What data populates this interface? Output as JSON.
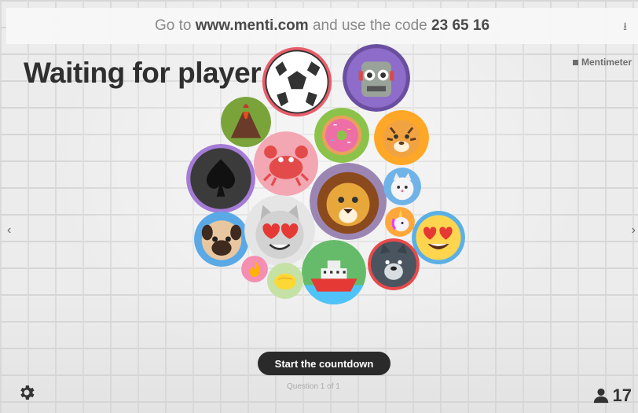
{
  "header": {
    "prefix": "Go to",
    "url": "www.menti.com",
    "middle": "and use the code",
    "code": "23 65 16",
    "download_icon": "download-icon"
  },
  "main": {
    "title": "Waiting for player",
    "brand": "Mentimeter"
  },
  "avatars": [
    {
      "name": "soccer-ball-avatar"
    },
    {
      "name": "robot-avatar"
    },
    {
      "name": "volcano-avatar"
    },
    {
      "name": "donut-avatar"
    },
    {
      "name": "tiger-avatar"
    },
    {
      "name": "crab-avatar"
    },
    {
      "name": "spade-avatar"
    },
    {
      "name": "lion-avatar"
    },
    {
      "name": "cat-avatar"
    },
    {
      "name": "unicorn-avatar"
    },
    {
      "name": "heart-eyes-avatar"
    },
    {
      "name": "pug-avatar"
    },
    {
      "name": "heart-eyes-cat-avatar"
    },
    {
      "name": "wolf-avatar"
    },
    {
      "name": "ship-avatar"
    },
    {
      "name": "fire-avatar"
    },
    {
      "name": "lemon-avatar"
    }
  ],
  "controls": {
    "start_label": "Start the countdown",
    "counter": "Question 1 of 1",
    "players_count": "17",
    "colors": {
      "button": "#2a2a2a",
      "text_dark": "#2f2f2f"
    }
  }
}
